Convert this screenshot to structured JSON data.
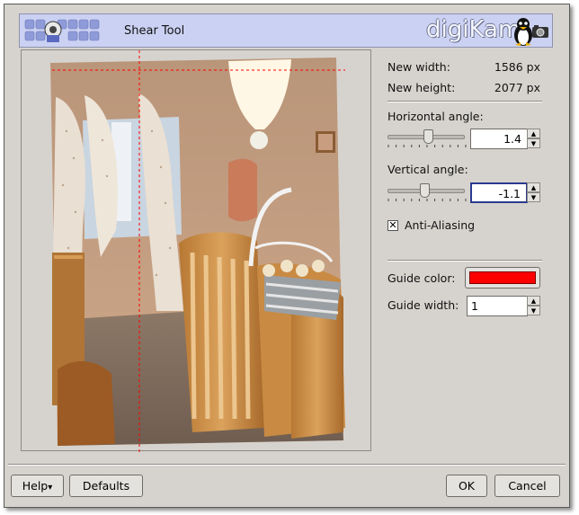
{
  "header": {
    "title": "Shear Tool",
    "brand": "digiKam"
  },
  "info": {
    "new_width_label": "New width:",
    "new_width_value": "1586 px",
    "new_height_label": "New height:",
    "new_height_value": "2077 px"
  },
  "horizontal": {
    "label": "Horizontal angle:",
    "value": "1.4",
    "slider_fraction": 0.52
  },
  "vertical": {
    "label": "Vertical angle:",
    "value": "-1.1",
    "slider_fraction": 0.48
  },
  "antialias": {
    "label": "Anti-Aliasing",
    "checked": true,
    "mark": "✕"
  },
  "guide": {
    "color_label": "Guide color:",
    "color": "#ff0000",
    "width_label": "Guide width:",
    "width_value": "1"
  },
  "buttons": {
    "help": "Help",
    "help_arrow": "▾",
    "defaults": "Defaults",
    "ok": "OK",
    "cancel": "Cancel"
  },
  "icons": {
    "spin_up": "▲",
    "spin_down": "▼"
  }
}
